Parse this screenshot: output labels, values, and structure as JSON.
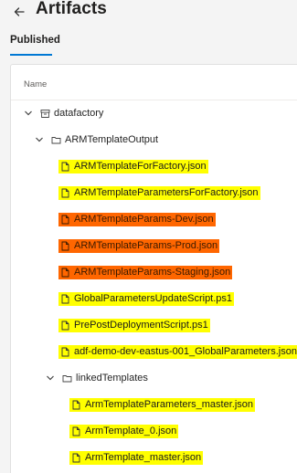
{
  "header": {
    "back_icon": "arrow-left-icon",
    "title": "Artifacts"
  },
  "tabs": [
    {
      "label": "Published",
      "selected": true
    }
  ],
  "table": {
    "column_header": "Name"
  },
  "tree": {
    "root": {
      "label": "datafactory",
      "icon": "repository-icon",
      "expanded": true
    },
    "arm_folder": {
      "label": "ARMTemplateOutput",
      "icon": "folder-icon",
      "expanded": true
    },
    "arm_files": [
      {
        "label": "ARMTemplateForFactory.json",
        "highlight": "#ffff00"
      },
      {
        "label": "ARMTemplateParametersForFactory.json",
        "highlight": "#ffff00"
      },
      {
        "label": "ARMTemplateParams-Dev.json",
        "highlight": "#ff6600"
      },
      {
        "label": "ARMTemplateParams-Prod.json",
        "highlight": "#ff6600"
      },
      {
        "label": "ARMTemplateParams-Staging.json",
        "highlight": "#ff6600"
      },
      {
        "label": "GlobalParametersUpdateScript.ps1",
        "highlight": "#ffff00"
      },
      {
        "label": "PrePostDeploymentScript.ps1",
        "highlight": "#ffff00"
      },
      {
        "label": "adf-demo-dev-eastus-001_GlobalParameters.json",
        "highlight": "#ffff00"
      }
    ],
    "linked_folder": {
      "label": "linkedTemplates",
      "icon": "folder-icon",
      "expanded": true
    },
    "linked_files": [
      {
        "label": "ArmTemplateParameters_master.json",
        "highlight": "#ffff00"
      },
      {
        "label": "ArmTemplate_0.json",
        "highlight": "#ffff00"
      },
      {
        "label": "ArmTemplate_master.json",
        "highlight": "#ffff00"
      }
    ]
  },
  "colors": {
    "accent": "#0078d4",
    "highlight_yellow": "#ffff00",
    "highlight_orange": "#ff6600"
  }
}
